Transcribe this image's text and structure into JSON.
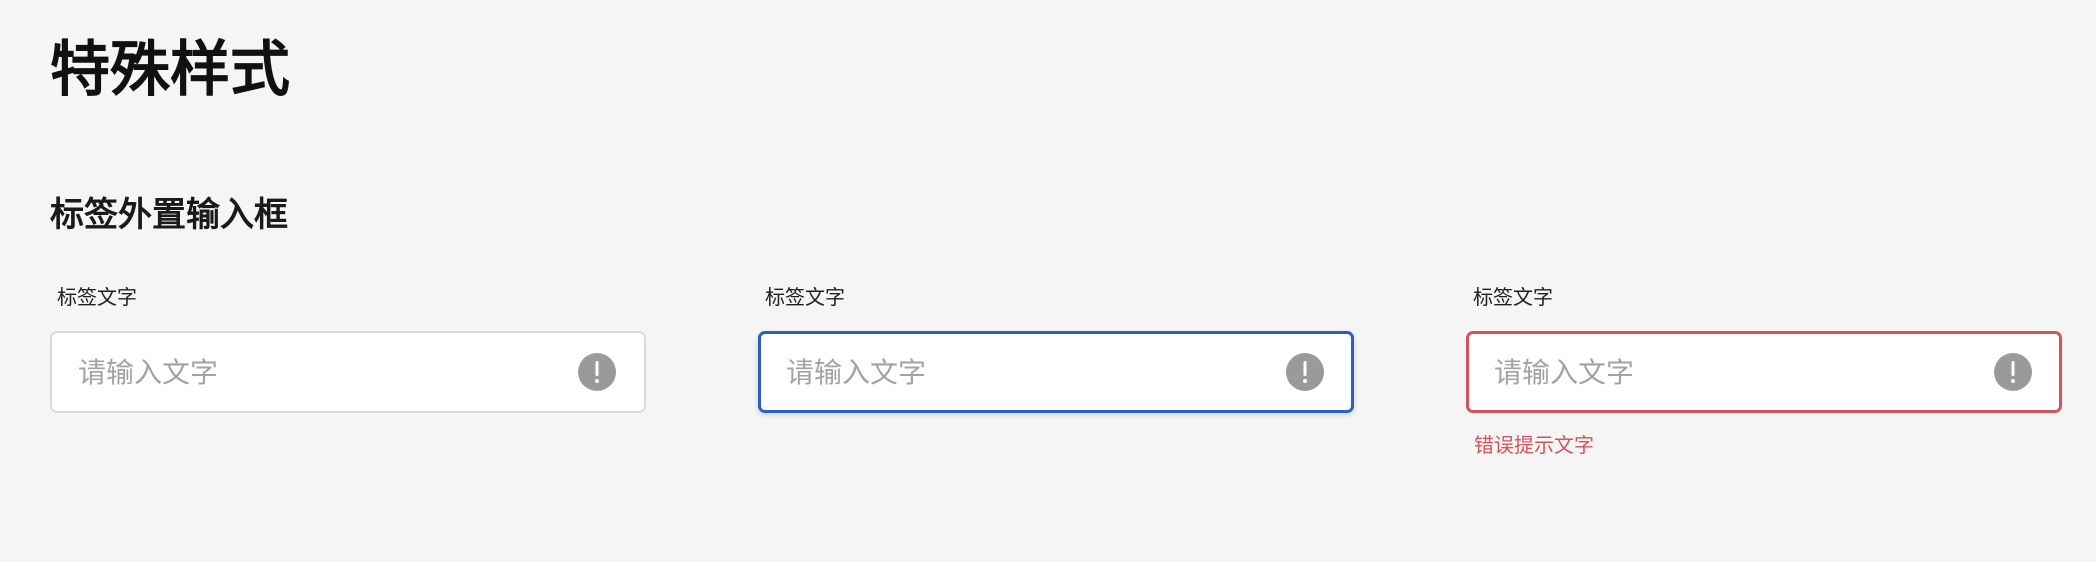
{
  "page": {
    "title": "特殊样式"
  },
  "section": {
    "title": "标签外置输入框"
  },
  "fields": [
    {
      "label": "标签文字",
      "placeholder": "请输入文字",
      "state": "default",
      "icon": "alert-icon"
    },
    {
      "label": "标签文字",
      "placeholder": "请输入文字",
      "state": "focused",
      "icon": "alert-icon"
    },
    {
      "label": "标签文字",
      "placeholder": "请输入文字",
      "state": "error",
      "icon": "alert-icon",
      "error_message": "错误提示文字"
    }
  ],
  "colors": {
    "background": "#f5f5f5",
    "default_border": "#dadada",
    "focus_border": "#2b5fc7",
    "error": "#d4545c",
    "icon": "#9a9a9a",
    "placeholder": "#a3a3a3"
  }
}
